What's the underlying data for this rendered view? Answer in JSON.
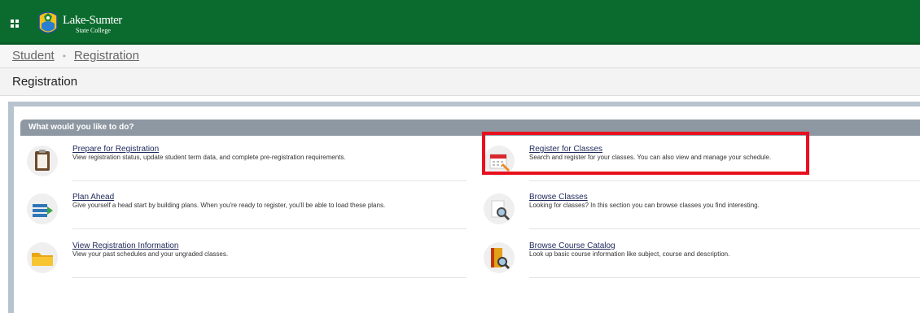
{
  "header": {
    "logo_line1": "Lake-Sumter",
    "logo_line2": "State College",
    "brand_color": "#0b6b2e"
  },
  "breadcrumb": {
    "items": [
      "Student",
      "Registration"
    ],
    "separator": "•"
  },
  "page_title": "Registration",
  "panel": {
    "header": "What would you like to do?",
    "items": [
      {
        "title": "Prepare for Registration",
        "desc": "View registration status, update student term data, and complete pre-registration requirements.",
        "icon": "clipboard-icon"
      },
      {
        "title": "Register for Classes",
        "desc": "Search and register for your classes. You can also view and manage your schedule.",
        "icon": "calendar-pencil-icon"
      },
      {
        "title": "Plan Ahead",
        "desc": "Give yourself a head start by building plans. When you're ready to register, you'll be able to load these plans.",
        "icon": "list-arrow-icon"
      },
      {
        "title": "Browse Classes",
        "desc": "Looking for classes? In this section you can browse classes you find interesting.",
        "icon": "magnifier-document-icon"
      },
      {
        "title": "View Registration Information",
        "desc": "View your past schedules and your ungraded classes.",
        "icon": "folder-icon"
      },
      {
        "title": "Browse Course Catalog",
        "desc": "Look up basic course information like subject, course and description.",
        "icon": "catalog-book-icon"
      }
    ]
  },
  "highlight_color": "#e8101e"
}
